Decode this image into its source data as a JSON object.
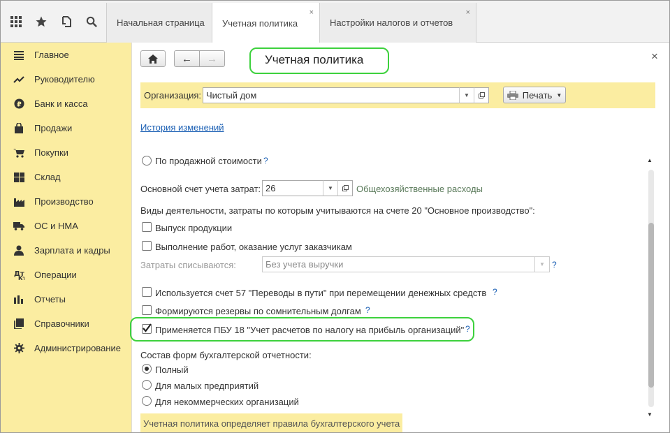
{
  "topbar": {
    "icons": [
      "apps-grid-icon",
      "star-icon",
      "history-icon",
      "search-icon"
    ],
    "tabs": [
      {
        "label": "Начальная страница",
        "active": false,
        "closable": false
      },
      {
        "label": "Учетная политика",
        "active": true,
        "closable": true
      },
      {
        "label": "Настройки налогов и отчетов",
        "active": false,
        "closable": true
      }
    ],
    "close_glyph": "×"
  },
  "sidebar": {
    "items": [
      {
        "label": "Главное",
        "icon": "menu-lines-icon"
      },
      {
        "label": "Руководителю",
        "icon": "trend-icon"
      },
      {
        "label": "Банк и касса",
        "icon": "ruble-coin-icon"
      },
      {
        "label": "Продажи",
        "icon": "shopping-bag-icon"
      },
      {
        "label": "Покупки",
        "icon": "cart-icon"
      },
      {
        "label": "Склад",
        "icon": "warehouse-icon"
      },
      {
        "label": "Производство",
        "icon": "factory-icon"
      },
      {
        "label": "ОС и НМА",
        "icon": "truck-icon"
      },
      {
        "label": "Зарплата и кадры",
        "icon": "person-icon"
      },
      {
        "label": "Операции",
        "icon": "operations-icon"
      },
      {
        "label": "Отчеты",
        "icon": "bar-chart-icon"
      },
      {
        "label": "Справочники",
        "icon": "books-icon"
      },
      {
        "label": "Администрирование",
        "icon": "gear-icon"
      }
    ]
  },
  "header": {
    "title": "Учетная политика",
    "home_glyph": "⌂",
    "back_glyph": "←",
    "forward_glyph": "→",
    "close_glyph": "×"
  },
  "org": {
    "label": "Организация:",
    "value": "Чистый дом",
    "print_label": "Печать"
  },
  "history_link": "История изменений",
  "form": {
    "radio_sale_price": "По продажной стоимости",
    "cost_account_label": "Основной счет учета затрат:",
    "cost_account_value": "26",
    "cost_account_desc": "Общехозяйственные расходы",
    "activities_label": "Виды деятельности, затраты по которым учитываются на счете 20 \"Основное производство\":",
    "cb_production": "Выпуск продукции",
    "cb_services": "Выполнение работ, оказание услуг заказчикам",
    "writeoff_label": "Затраты списываются:",
    "writeoff_value": "Без учета выручки",
    "cb_account57": "Используется счет 57 \"Переводы в пути\" при перемещении денежных средств",
    "cb_reserves": "Формируются резервы по сомнительным долгам",
    "cb_pbu18": "Применяется ПБУ 18 \"Учет расчетов по налогу на прибыль организаций\"",
    "pbu18_checked": true,
    "forms_label": "Состав форм бухгалтерской отчетности:",
    "radio_full": "Полный",
    "radio_small": "Для малых предприятий",
    "radio_nonprofit": "Для некоммерческих организаций",
    "selected_form": "Полный",
    "help_glyph": "?",
    "bottom_note": "Учетная политика определяет правила бухгалтерского учета"
  },
  "colors": {
    "accent_yellow": "#fbeda1",
    "link": "#1a5fb4",
    "highlight": "#3dd13d"
  }
}
